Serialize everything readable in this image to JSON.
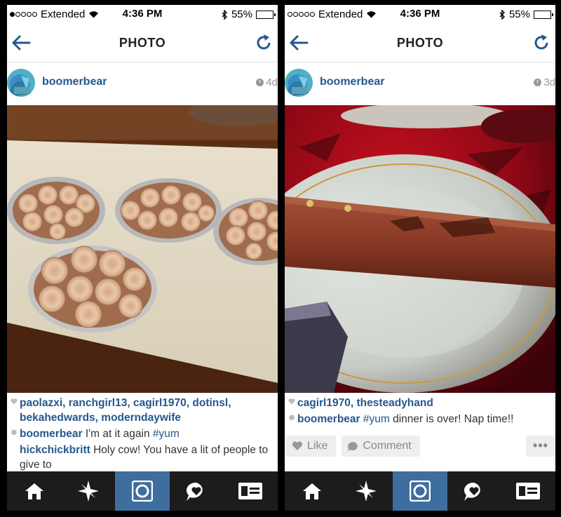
{
  "left": {
    "status": {
      "carrier": "Extended",
      "time": "4:36 PM",
      "battery": "55%",
      "battery_level": 0.55
    },
    "nav": {
      "title": "PHOTO"
    },
    "post": {
      "username": "boomerbear",
      "age": "4d"
    },
    "likes": "paolazxi, ranchgirl13, cagirl1970, dotinsl, bekahedwards, moderndaywife",
    "comments": [
      {
        "user": "boomerbear",
        "text": " I'm at it again ",
        "tag": "#yum"
      },
      {
        "user": "hickchickbritt",
        "text": " Holy cow! You have a lit of people to give to",
        "tag": ""
      }
    ]
  },
  "right": {
    "status": {
      "carrier": "Extended",
      "time": "4:36 PM",
      "battery": "55%",
      "battery_level": 0.55
    },
    "nav": {
      "title": "PHOTO"
    },
    "post": {
      "username": "boomerbear",
      "age": "3d"
    },
    "likes": "cagirl1970, thesteadyhand",
    "comments": [
      {
        "user": "boomerbear",
        "tag": "#yum",
        "text": " dinner is over! Nap time!!"
      }
    ],
    "actions": {
      "like": "Like",
      "comment": "Comment",
      "more": "•••"
    }
  },
  "colors": {
    "link": "#26588c",
    "tab_active": "#3e6e9e",
    "tab_bar": "#1c1c1c"
  },
  "tabs": [
    "home-icon",
    "explore-icon",
    "camera-icon",
    "activity-icon",
    "profile-icon"
  ]
}
